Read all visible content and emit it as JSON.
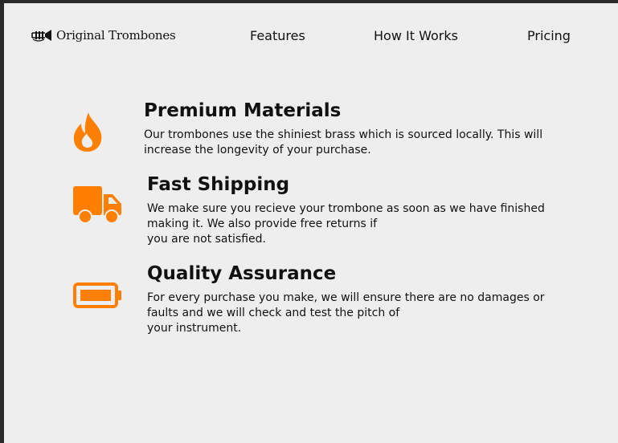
{
  "brand": {
    "name": "Original Trombones",
    "icon": "trumpet-logo-icon"
  },
  "nav": {
    "items": [
      "Features",
      "How It Works",
      "Pricing"
    ]
  },
  "accent_color": "#ff8000",
  "features": [
    {
      "icon": "fire-icon",
      "title": "Premium Materials",
      "lines": [
        "Our trombones use the shiniest brass which is sourced locally. This will",
        "increase the longevity of your purchase."
      ]
    },
    {
      "icon": "truck-icon",
      "title": "Fast Shipping",
      "lines": [
        "We make sure you recieve your trombone as soon as we have finished",
        "making it. We also provide free returns if",
        "you are not satisfied."
      ]
    },
    {
      "icon": "battery-icon",
      "title": "Quality Assurance",
      "lines": [
        "For every purchase you make, we will ensure there are no damages or",
        "faults and we will check and test the pitch of",
        "your instrument."
      ]
    }
  ]
}
